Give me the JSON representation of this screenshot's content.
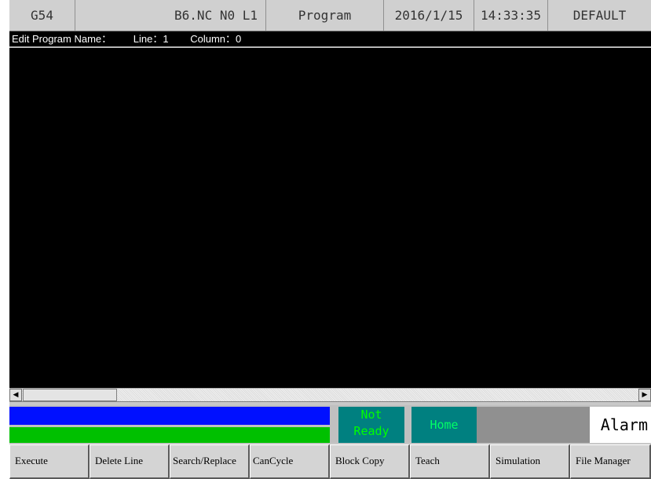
{
  "header": {
    "coord_system": "G54",
    "program_info": "B6.NC N0 L1",
    "mode": "Program",
    "date": "2016/1/15",
    "time": "14:33:35",
    "profile": "DEFAULT"
  },
  "edit_bar": {
    "program_name_label": "Edit Program Name：",
    "line_label": "Line：1",
    "column_label": "Column：0"
  },
  "scrollbar": {
    "left_arrow": "◀",
    "right_arrow": "▶"
  },
  "status": {
    "not_ready_line1": "Not",
    "not_ready_line2": "Ready",
    "home": "Home",
    "alarm": "Alarm"
  },
  "colors": {
    "blue_bar": "#0010ff",
    "green_bar": "#00c000",
    "status_teal": "#008080"
  },
  "function_keys": [
    "Execute",
    "Delete Line",
    "Search/Replace",
    "CanCycle",
    "Block Copy",
    "Teach",
    "Simulation",
    "File Manager"
  ]
}
